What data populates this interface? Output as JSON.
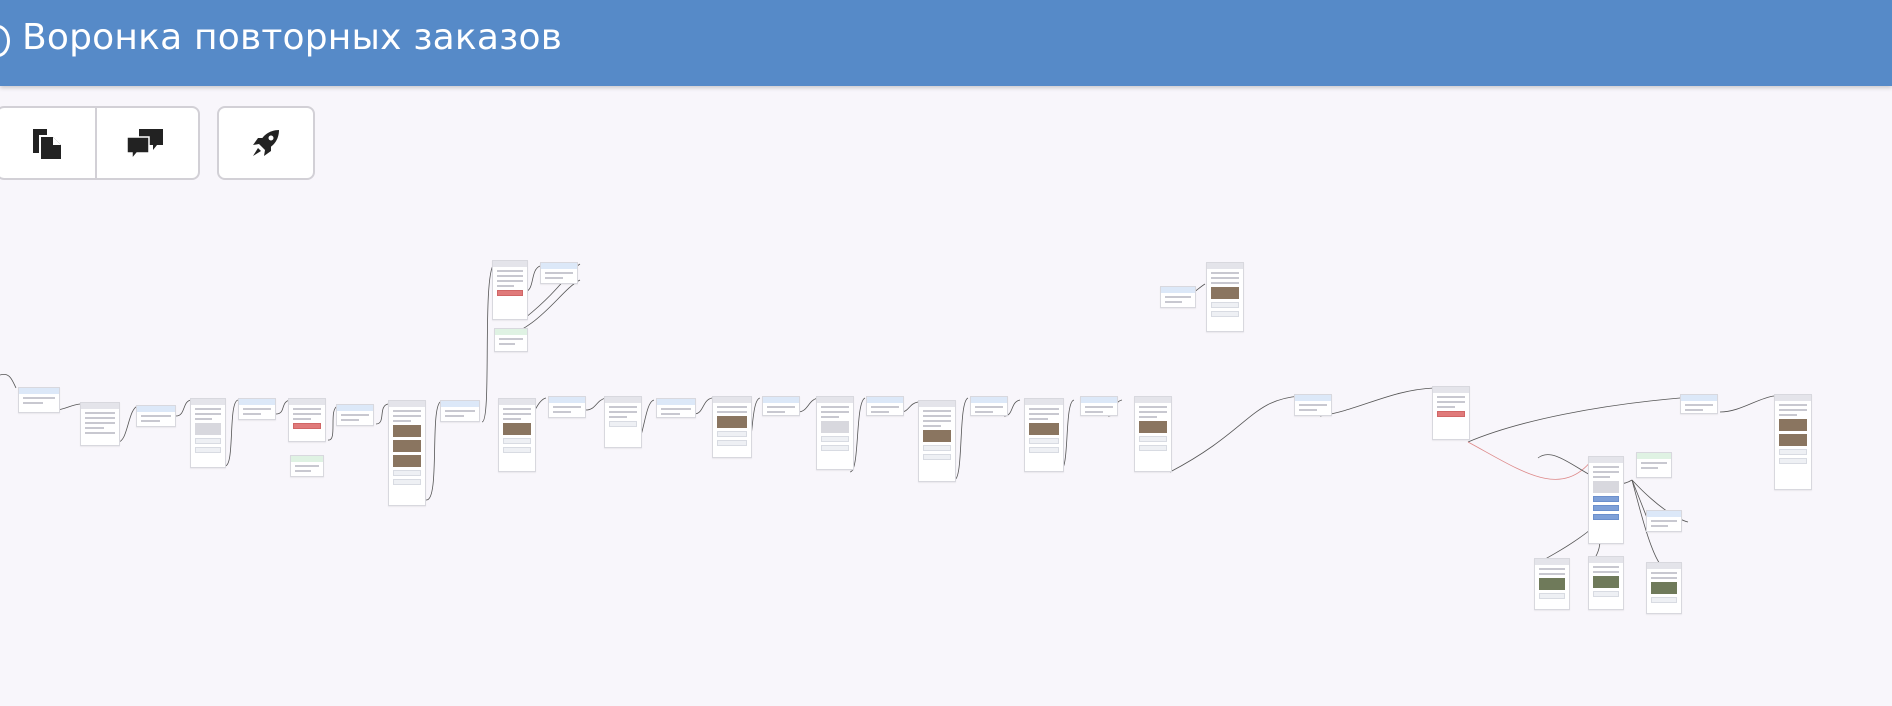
{
  "header": {
    "title": "Воронка повторных заказов"
  },
  "toolbar": {
    "buttons": [
      {
        "icon": "document-copy-icon"
      },
      {
        "icon": "chat-bubbles-icon"
      },
      {
        "icon": "rocket-icon"
      }
    ]
  },
  "colors": {
    "header_bg": "#568ac8",
    "canvas_bg": "#f8f6fb",
    "trigger_node": "#dce8f8",
    "condition_node": "#dff2e3",
    "red_button": "#e07a7a",
    "blue_button": "#7ea0d8"
  }
}
